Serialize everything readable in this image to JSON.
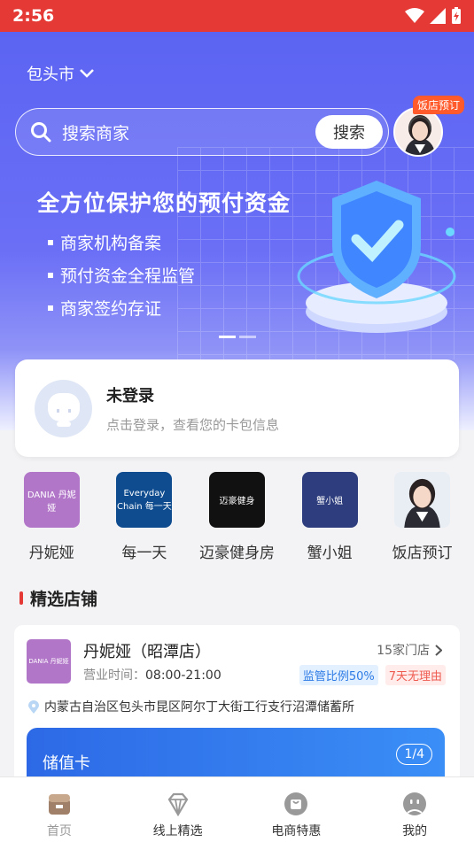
{
  "status_bar": {
    "time": "2:56"
  },
  "header": {
    "city": "包头市",
    "search_placeholder": "搜索商家",
    "search_button": "搜索",
    "avatar_tag": "饭店预订"
  },
  "banner": {
    "title": "全方位保护您的预付资金",
    "bullets": [
      "商家机构备案",
      "预付资金全程监管",
      "商家签约存证"
    ]
  },
  "login_card": {
    "title": "未登录",
    "subtitle": "点击登录，查看您的卡包信息"
  },
  "quick_links": [
    {
      "label": "丹妮娅",
      "logo_text": "DANIA 丹妮娅",
      "color": "#b276c9"
    },
    {
      "label": "每一天",
      "logo_text": "Everyday Chain 每一天",
      "color": "#0e4c8f"
    },
    {
      "label": "迈豪健身房",
      "logo_text": "迈豪健身",
      "color": "#111111"
    },
    {
      "label": "蟹小姐",
      "logo_text": "蟹小姐",
      "color": "#2d3d7d"
    },
    {
      "label": "饭店预订",
      "logo_text": "",
      "color": "#e9eef5"
    }
  ],
  "section": {
    "title": "精选店铺"
  },
  "store": {
    "name": "丹妮娅（昭潭店）",
    "hours_label": "营业时间：",
    "hours": "08:00-21:00",
    "store_count": "15家门店",
    "tag_supervision": "监管比例50%",
    "tag_refund": "7天无理由",
    "address": "内蒙古自治区包头市昆区阿尔丁大街工行支行沼潭储蓄所",
    "card_label": "储值卡",
    "card_page": "1/4",
    "logo_text": "DANIA 丹妮娅"
  },
  "tabbar": [
    {
      "label": "首页"
    },
    {
      "label": "线上精选"
    },
    {
      "label": "电商特惠"
    },
    {
      "label": "我的"
    }
  ],
  "colors": {
    "status_bar": "#e53935",
    "accent": "#5b64f2",
    "tag_blue": "#2d7be5",
    "tag_red": "#ef5a4f"
  }
}
